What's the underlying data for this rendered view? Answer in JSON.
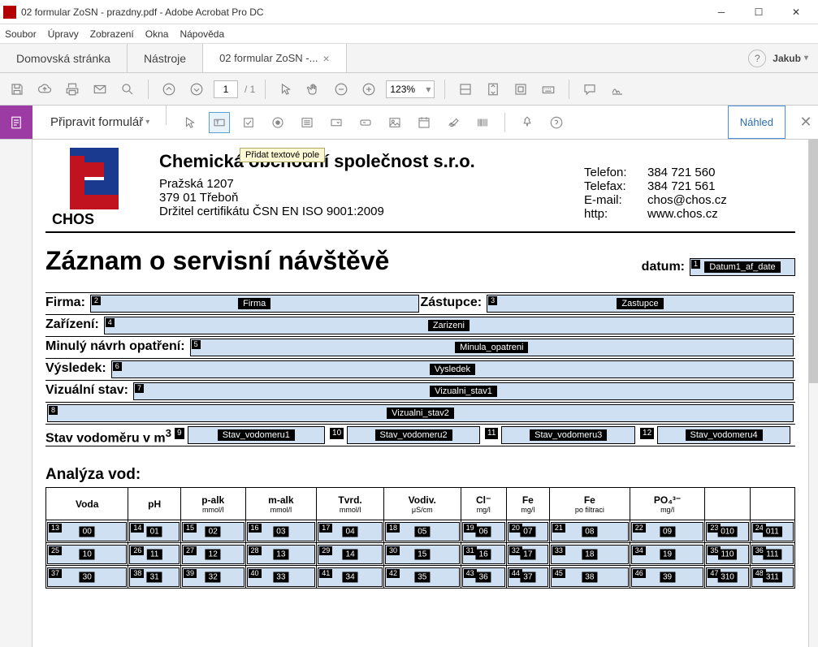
{
  "window": {
    "title": "02 formular ZoSN - prazdny.pdf - Adobe Acrobat Pro DC"
  },
  "menu": {
    "file": "Soubor",
    "edit": "Úpravy",
    "view": "Zobrazení",
    "window": "Okna",
    "help": "Nápověda"
  },
  "tabs": {
    "home": "Domovská stránka",
    "tools": "Nástroje",
    "doc": "02 formular ZoSN -..."
  },
  "user": "Jakub",
  "toolbar": {
    "page": "1",
    "pages": "/ 1",
    "zoom": "123%"
  },
  "formbar": {
    "label": "Připravit formulář",
    "preview": "Náhled",
    "tooltip": "Přidat textové pole"
  },
  "doc": {
    "company": {
      "name": "Chemická obchodní společnost s.r.o.",
      "addr1": "Pražská 1207",
      "addr2": "379 01 Třeboň",
      "cert": "Držitel certifikátu ČSN EN ISO 9001:2009",
      "logo_label": "CHOS"
    },
    "contact": {
      "tel_l": "Telefon:",
      "tel_v": "384 721 560",
      "fax_l": "Telefax:",
      "fax_v": "384 721 561",
      "em_l": "E-mail:",
      "em_v": "chos@chos.cz",
      "http_l": "http:",
      "http_v": "www.chos.cz"
    },
    "title": "Záznam o servisní návštěvě",
    "datum_l": "datum:",
    "f": {
      "datum": {
        "n": "1",
        "l": "Datum1_af_date"
      },
      "firma_l": "Firma:",
      "firma": {
        "n": "2",
        "l": "Firma"
      },
      "zast_l": "Zástupce:",
      "zast": {
        "n": "3",
        "l": "Zastupce"
      },
      "zar_l": "Zařízení:",
      "zar": {
        "n": "4",
        "l": "Zarizeni"
      },
      "min_l": "Minulý návrh opatření:",
      "min": {
        "n": "5",
        "l": "Minula_opatreni"
      },
      "vys_l": "Výsledek:",
      "vys": {
        "n": "6",
        "l": "Vysledek"
      },
      "viz_l": "Vizuální stav:",
      "viz1": {
        "n": "7",
        "l": "Vizualni_stav1"
      },
      "viz2": {
        "n": "8",
        "l": "Vizualni_stav2"
      },
      "vod_l": "Stav vodoměru v m",
      "vod1": {
        "n": "9",
        "l": "Stav_vodomeru1"
      },
      "vod2": {
        "n": "10",
        "l": "Stav_vodomeru2"
      },
      "vod3": {
        "n": "11",
        "l": "Stav_vodomeru3"
      },
      "vod4": {
        "n": "12",
        "l": "Stav_vodomeru4"
      }
    },
    "anal_l": "Analýza vod:",
    "th": {
      "voda": "Voda",
      "ph": "pH",
      "palk": "p-alk",
      "palk_s": "mmol/l",
      "malk": "m-alk",
      "malk_s": "mmol/l",
      "tvrd": "Tvrd.",
      "tvrd_s": "mmol/l",
      "vodiv": "Vodiv.",
      "vodiv_s": "μS/cm",
      "cl": "Cl⁻",
      "cl_s": "mg/l",
      "fe": "Fe",
      "fe_s": "mg/l",
      "fef": "Fe",
      "fef_s": "po filtraci",
      "po4": "PO₄³⁻",
      "po4_s": "mg/l",
      "blank": ""
    },
    "rows": [
      [
        {
          "n": "13",
          "l": "00"
        },
        {
          "n": "14",
          "l": "01"
        },
        {
          "n": "15",
          "l": "02"
        },
        {
          "n": "16",
          "l": "03"
        },
        {
          "n": "17",
          "l": "04"
        },
        {
          "n": "18",
          "l": "05"
        },
        {
          "n": "19",
          "l": "06"
        },
        {
          "n": "20",
          "l": "07"
        },
        {
          "n": "21",
          "l": "08"
        },
        {
          "n": "22",
          "l": "09"
        },
        {
          "n": "23",
          "l": "010"
        },
        {
          "n": "24",
          "l": "011"
        }
      ],
      [
        {
          "n": "25",
          "l": "10"
        },
        {
          "n": "26",
          "l": "11"
        },
        {
          "n": "27",
          "l": "12"
        },
        {
          "n": "28",
          "l": "13"
        },
        {
          "n": "29",
          "l": "14"
        },
        {
          "n": "30",
          "l": "15"
        },
        {
          "n": "31",
          "l": "16"
        },
        {
          "n": "32",
          "l": "17"
        },
        {
          "n": "33",
          "l": "18"
        },
        {
          "n": "34",
          "l": "19"
        },
        {
          "n": "35",
          "l": "110"
        },
        {
          "n": "36",
          "l": "111"
        }
      ],
      [
        {
          "n": "37",
          "l": "30"
        },
        {
          "n": "38",
          "l": "31"
        },
        {
          "n": "39",
          "l": "32"
        },
        {
          "n": "40",
          "l": "33"
        },
        {
          "n": "41",
          "l": "34"
        },
        {
          "n": "42",
          "l": "35"
        },
        {
          "n": "43",
          "l": "36"
        },
        {
          "n": "44",
          "l": "37"
        },
        {
          "n": "45",
          "l": "38"
        },
        {
          "n": "46",
          "l": "39"
        },
        {
          "n": "47",
          "l": "310"
        },
        {
          "n": "48",
          "l": "311"
        }
      ]
    ]
  }
}
